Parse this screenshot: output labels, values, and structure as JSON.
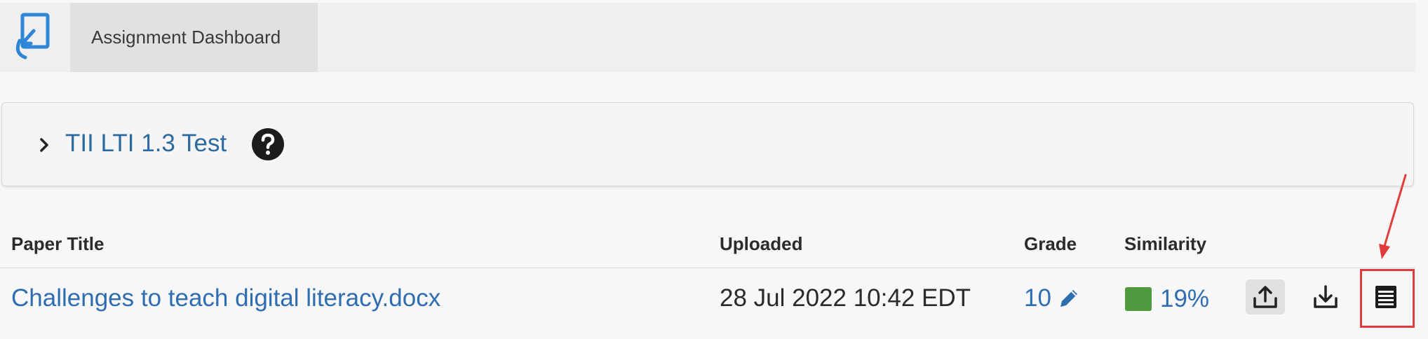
{
  "nav": {
    "tab_label": "Assignment Dashboard",
    "logo_icon": "turnitin-return-icon"
  },
  "assignment": {
    "title": "TII LTI 1.3 Test",
    "expand_icon": "chevron-right-icon",
    "help_icon": "question-circle-icon"
  },
  "table": {
    "headers": {
      "paper_title": "Paper Title",
      "uploaded": "Uploaded",
      "grade": "Grade",
      "similarity": "Similarity"
    },
    "rows": [
      {
        "paper_title": "Challenges to teach digital literacy.docx",
        "uploaded": "28 Jul 2022 10:42 EDT",
        "grade": "10",
        "similarity": "19%",
        "similarity_color": "#4d9a3f",
        "actions": [
          "upload-icon",
          "download-icon",
          "report-list-icon"
        ]
      }
    ]
  },
  "colors": {
    "link": "#2f6db1",
    "annotation": "#e23b3b"
  }
}
